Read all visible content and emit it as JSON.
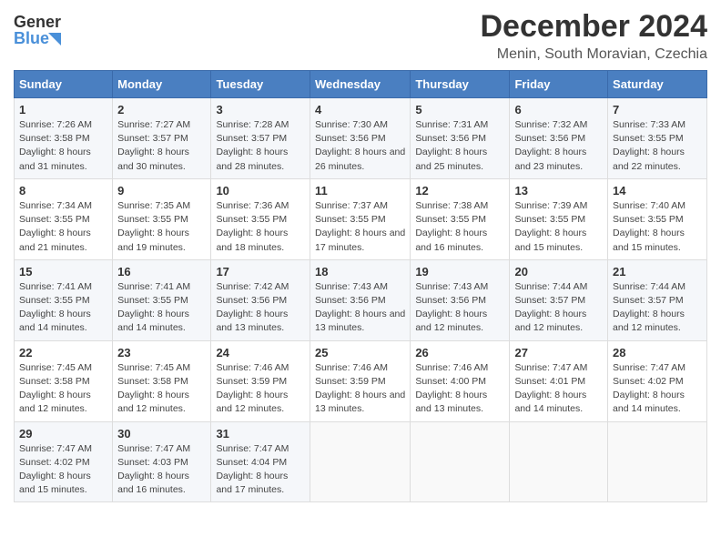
{
  "header": {
    "logo_line1": "General",
    "logo_line2": "Blue",
    "title": "December 2024",
    "subtitle": "Menin, South Moravian, Czechia"
  },
  "weekdays": [
    "Sunday",
    "Monday",
    "Tuesday",
    "Wednesday",
    "Thursday",
    "Friday",
    "Saturday"
  ],
  "weeks": [
    [
      {
        "day": "1",
        "sunrise": "Sunrise: 7:26 AM",
        "sunset": "Sunset: 3:58 PM",
        "daylight": "Daylight: 8 hours and 31 minutes."
      },
      {
        "day": "2",
        "sunrise": "Sunrise: 7:27 AM",
        "sunset": "Sunset: 3:57 PM",
        "daylight": "Daylight: 8 hours and 30 minutes."
      },
      {
        "day": "3",
        "sunrise": "Sunrise: 7:28 AM",
        "sunset": "Sunset: 3:57 PM",
        "daylight": "Daylight: 8 hours and 28 minutes."
      },
      {
        "day": "4",
        "sunrise": "Sunrise: 7:30 AM",
        "sunset": "Sunset: 3:56 PM",
        "daylight": "Daylight: 8 hours and 26 minutes."
      },
      {
        "day": "5",
        "sunrise": "Sunrise: 7:31 AM",
        "sunset": "Sunset: 3:56 PM",
        "daylight": "Daylight: 8 hours and 25 minutes."
      },
      {
        "day": "6",
        "sunrise": "Sunrise: 7:32 AM",
        "sunset": "Sunset: 3:56 PM",
        "daylight": "Daylight: 8 hours and 23 minutes."
      },
      {
        "day": "7",
        "sunrise": "Sunrise: 7:33 AM",
        "sunset": "Sunset: 3:55 PM",
        "daylight": "Daylight: 8 hours and 22 minutes."
      }
    ],
    [
      {
        "day": "8",
        "sunrise": "Sunrise: 7:34 AM",
        "sunset": "Sunset: 3:55 PM",
        "daylight": "Daylight: 8 hours and 21 minutes."
      },
      {
        "day": "9",
        "sunrise": "Sunrise: 7:35 AM",
        "sunset": "Sunset: 3:55 PM",
        "daylight": "Daylight: 8 hours and 19 minutes."
      },
      {
        "day": "10",
        "sunrise": "Sunrise: 7:36 AM",
        "sunset": "Sunset: 3:55 PM",
        "daylight": "Daylight: 8 hours and 18 minutes."
      },
      {
        "day": "11",
        "sunrise": "Sunrise: 7:37 AM",
        "sunset": "Sunset: 3:55 PM",
        "daylight": "Daylight: 8 hours and 17 minutes."
      },
      {
        "day": "12",
        "sunrise": "Sunrise: 7:38 AM",
        "sunset": "Sunset: 3:55 PM",
        "daylight": "Daylight: 8 hours and 16 minutes."
      },
      {
        "day": "13",
        "sunrise": "Sunrise: 7:39 AM",
        "sunset": "Sunset: 3:55 PM",
        "daylight": "Daylight: 8 hours and 15 minutes."
      },
      {
        "day": "14",
        "sunrise": "Sunrise: 7:40 AM",
        "sunset": "Sunset: 3:55 PM",
        "daylight": "Daylight: 8 hours and 15 minutes."
      }
    ],
    [
      {
        "day": "15",
        "sunrise": "Sunrise: 7:41 AM",
        "sunset": "Sunset: 3:55 PM",
        "daylight": "Daylight: 8 hours and 14 minutes."
      },
      {
        "day": "16",
        "sunrise": "Sunrise: 7:41 AM",
        "sunset": "Sunset: 3:55 PM",
        "daylight": "Daylight: 8 hours and 14 minutes."
      },
      {
        "day": "17",
        "sunrise": "Sunrise: 7:42 AM",
        "sunset": "Sunset: 3:56 PM",
        "daylight": "Daylight: 8 hours and 13 minutes."
      },
      {
        "day": "18",
        "sunrise": "Sunrise: 7:43 AM",
        "sunset": "Sunset: 3:56 PM",
        "daylight": "Daylight: 8 hours and 13 minutes."
      },
      {
        "day": "19",
        "sunrise": "Sunrise: 7:43 AM",
        "sunset": "Sunset: 3:56 PM",
        "daylight": "Daylight: 8 hours and 12 minutes."
      },
      {
        "day": "20",
        "sunrise": "Sunrise: 7:44 AM",
        "sunset": "Sunset: 3:57 PM",
        "daylight": "Daylight: 8 hours and 12 minutes."
      },
      {
        "day": "21",
        "sunrise": "Sunrise: 7:44 AM",
        "sunset": "Sunset: 3:57 PM",
        "daylight": "Daylight: 8 hours and 12 minutes."
      }
    ],
    [
      {
        "day": "22",
        "sunrise": "Sunrise: 7:45 AM",
        "sunset": "Sunset: 3:58 PM",
        "daylight": "Daylight: 8 hours and 12 minutes."
      },
      {
        "day": "23",
        "sunrise": "Sunrise: 7:45 AM",
        "sunset": "Sunset: 3:58 PM",
        "daylight": "Daylight: 8 hours and 12 minutes."
      },
      {
        "day": "24",
        "sunrise": "Sunrise: 7:46 AM",
        "sunset": "Sunset: 3:59 PM",
        "daylight": "Daylight: 8 hours and 12 minutes."
      },
      {
        "day": "25",
        "sunrise": "Sunrise: 7:46 AM",
        "sunset": "Sunset: 3:59 PM",
        "daylight": "Daylight: 8 hours and 13 minutes."
      },
      {
        "day": "26",
        "sunrise": "Sunrise: 7:46 AM",
        "sunset": "Sunset: 4:00 PM",
        "daylight": "Daylight: 8 hours and 13 minutes."
      },
      {
        "day": "27",
        "sunrise": "Sunrise: 7:47 AM",
        "sunset": "Sunset: 4:01 PM",
        "daylight": "Daylight: 8 hours and 14 minutes."
      },
      {
        "day": "28",
        "sunrise": "Sunrise: 7:47 AM",
        "sunset": "Sunset: 4:02 PM",
        "daylight": "Daylight: 8 hours and 14 minutes."
      }
    ],
    [
      {
        "day": "29",
        "sunrise": "Sunrise: 7:47 AM",
        "sunset": "Sunset: 4:02 PM",
        "daylight": "Daylight: 8 hours and 15 minutes."
      },
      {
        "day": "30",
        "sunrise": "Sunrise: 7:47 AM",
        "sunset": "Sunset: 4:03 PM",
        "daylight": "Daylight: 8 hours and 16 minutes."
      },
      {
        "day": "31",
        "sunrise": "Sunrise: 7:47 AM",
        "sunset": "Sunset: 4:04 PM",
        "daylight": "Daylight: 8 hours and 17 minutes."
      },
      null,
      null,
      null,
      null
    ]
  ]
}
